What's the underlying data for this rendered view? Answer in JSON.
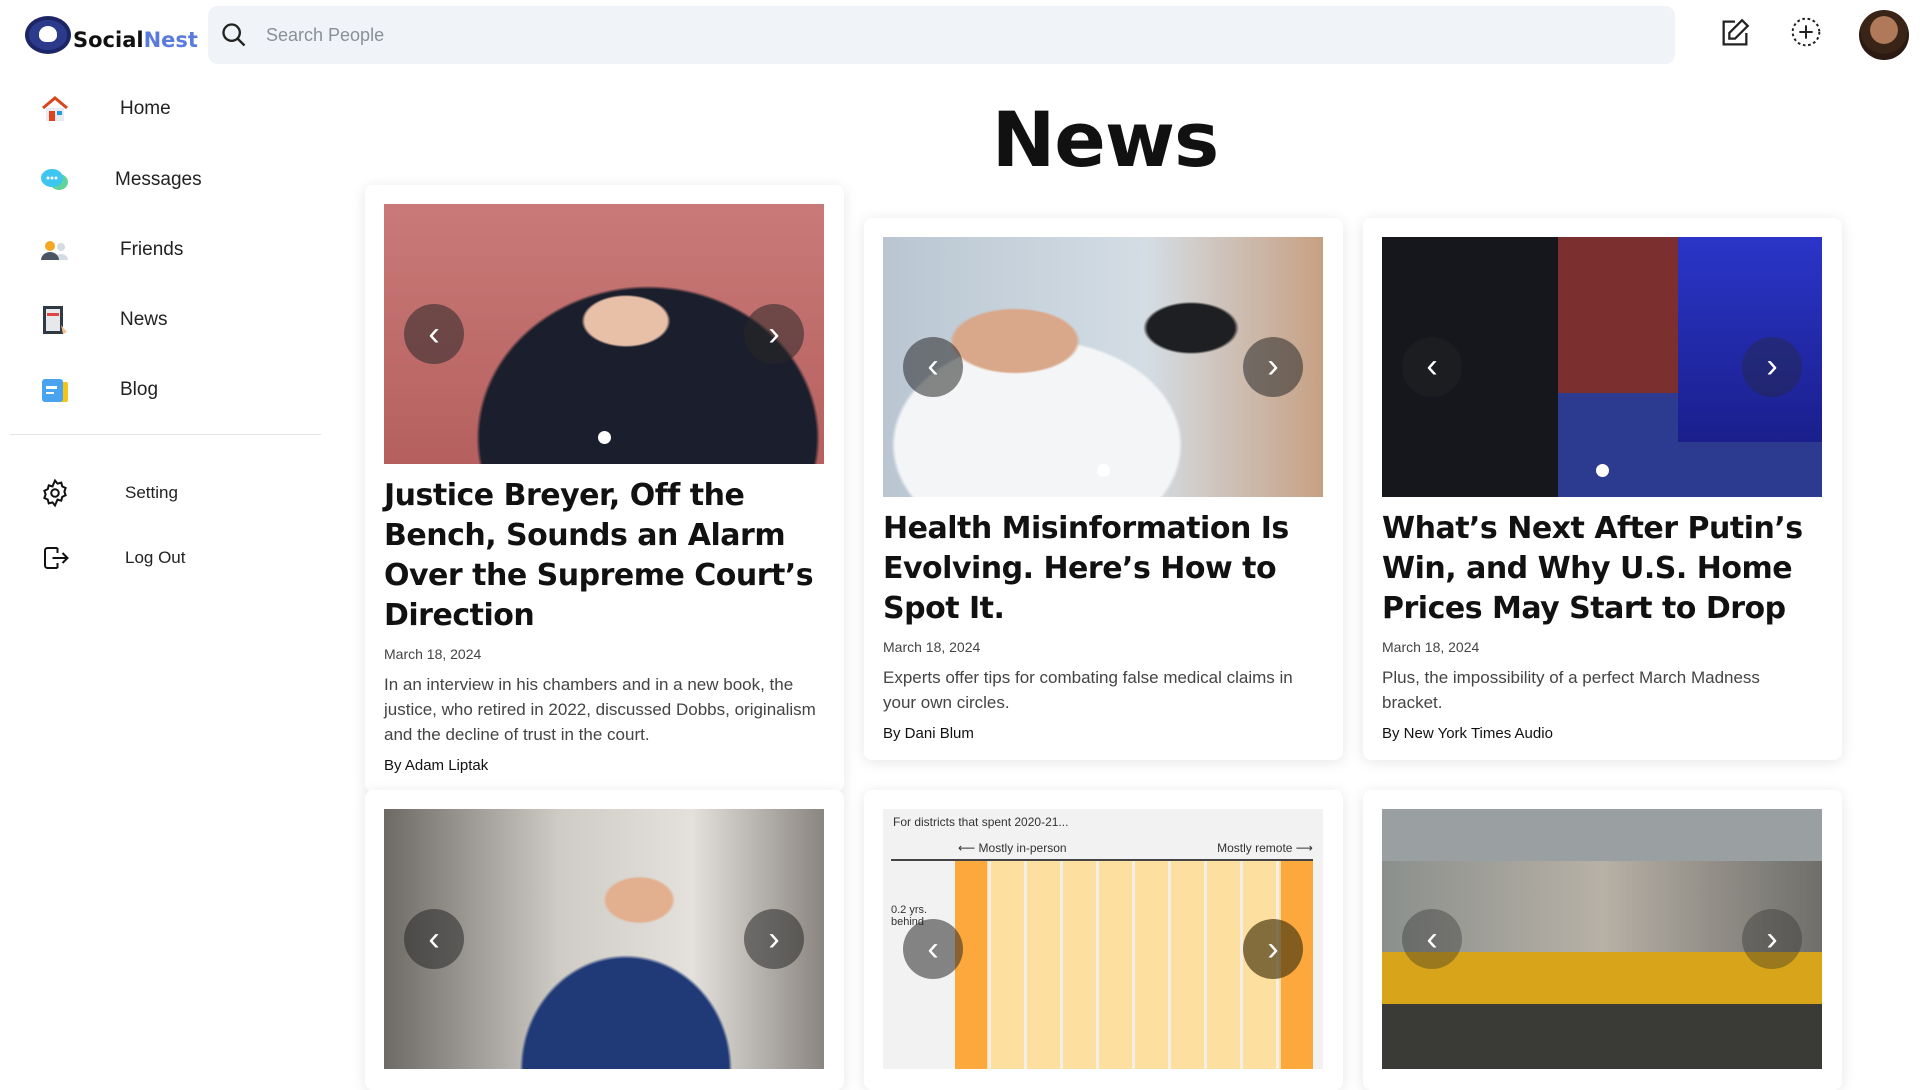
{
  "brand": {
    "part1": "Social",
    "part2": "Nest"
  },
  "search": {
    "placeholder": "Search People"
  },
  "sidebar": {
    "items": [
      {
        "label": "Home",
        "icon": "home-icon"
      },
      {
        "label": "Messages",
        "icon": "chat-icon"
      },
      {
        "label": "Friends",
        "icon": "friends-icon"
      },
      {
        "label": "News",
        "icon": "newspaper-icon"
      },
      {
        "label": "Blog",
        "icon": "blog-icon"
      }
    ],
    "bottom": [
      {
        "label": "Setting",
        "icon": "gear-icon"
      },
      {
        "label": "Log Out",
        "icon": "logout-icon"
      }
    ]
  },
  "page": {
    "title": "News"
  },
  "articles": [
    {
      "title": "Justice Breyer, Off the Bench, Sounds an Alarm Over the Supreme Court’s Direction",
      "date": "March 18, 2024",
      "description": "In an interview in his chambers and in a new book, the justice, who retired in 2022, discussed Dobbs, originalism and the decline of trust in the court.",
      "author": "By Adam Liptak"
    },
    {
      "title": "Health Misinformation Is Evolving. Here’s How to Spot It.",
      "date": "March 18, 2024",
      "description": "Experts offer tips for combating false medical claims in your own circles.",
      "author": "By Dani Blum"
    },
    {
      "title": "What’s Next After Putin’s Win, and Why U.S. Home Prices May Start to Drop",
      "date": "March 18, 2024",
      "description": "Plus, the impossibility of a perfect March Madness bracket.",
      "author": "By New York Times Audio"
    }
  ],
  "second_row_chart_image": {
    "subtitle": "For districts that spent 2020-21...",
    "left_label": "Mostly in-person",
    "right_label": "Mostly remote",
    "y_label": "0.2 yrs. behind"
  },
  "colors": {
    "brand_dark": "#1c2566",
    "brand_light": "#5b7bdc",
    "search_bg": "#f0f3f8"
  }
}
